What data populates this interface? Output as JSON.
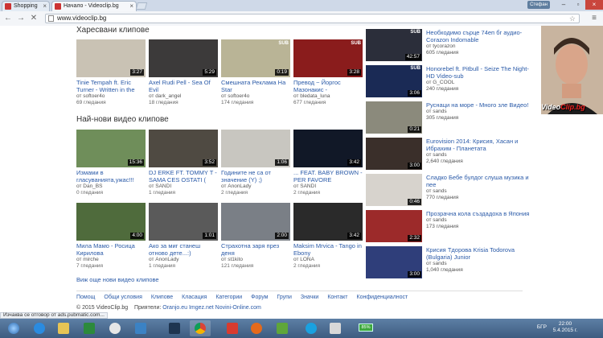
{
  "browser": {
    "tabs": [
      {
        "label": "Shopping",
        "active": false
      },
      {
        "label": "Начало - Videoclip.bg",
        "active": true
      }
    ],
    "user_badge": "Стефан",
    "url": "www.videoclip.bg",
    "status_text": "Изчаква се отговор от ads.pubmatic.com..."
  },
  "sections": {
    "favorites_title": "Харесвани клипове",
    "newest_title": "Най-нови видео клипове",
    "more_link": "Виж още нови видео клипове"
  },
  "favorites": [
    {
      "title": "Tinie Tempah ft. Eric Turner - Written in the",
      "author": "от softoer4o",
      "views": "69 гледания",
      "duration": "3:27",
      "sub": false,
      "color": "#c9c2b4"
    },
    {
      "title": "Axel Rudi Pell - Sea Of Evil",
      "author": "от dark_angel",
      "views": "18 гледания",
      "duration": "5:29",
      "sub": false,
      "color": "#3c3a3a"
    },
    {
      "title": "Смешната Реклама На Star",
      "author": "от softoer4o",
      "views": "174 гледания",
      "duration": "0:19",
      "sub": true,
      "color": "#b9b496"
    },
    {
      "title": "Превод ~ Йоргос Мазонакис -",
      "author": "от bledata_luna",
      "views": "677 гледания",
      "duration": "3:28",
      "sub": true,
      "color": "#8a1c1c"
    }
  ],
  "newest": [
    {
      "title": "Измами в гласуванията,ужас!!!",
      "author": "от Dan_BS",
      "views": "0 гледания",
      "duration": "15:36",
      "sub": false,
      "color": "#6f8e5a"
    },
    {
      "title": "DJ ERKE FT. TOMMY T - SAMA CES OSTATI (",
      "author": "от SANDI",
      "views": "1 гледания",
      "duration": "3:52",
      "sub": false,
      "color": "#4f4a42"
    },
    {
      "title": "Годините не са от значение (Y) ;)",
      "author": "от AnonLady",
      "views": "2 гледания",
      "duration": "1:06",
      "sub": false,
      "color": "#c8c6c0"
    },
    {
      "title": "... FEAT. BABY BROWN - PER FAVORE",
      "author": "от SANDI",
      "views": "2 гледания",
      "duration": "3:42",
      "sub": false,
      "color": "#111827"
    },
    {
      "title": "Мила Мамо - Росица Кирилова",
      "author": "от mirche",
      "views": "7 гледания",
      "duration": "4:00",
      "sub": false,
      "color": "#4f6b3c"
    },
    {
      "title": "Ако за миг станеш отново дете...:)",
      "author": "от AnonLady",
      "views": "1 гледания",
      "duration": "1:01",
      "sub": false,
      "color": "#5a5a5a"
    },
    {
      "title": "Страхотна заря през деня",
      "author": "от st1kito",
      "views": "121 гледания",
      "duration": "2:00",
      "sub": false,
      "color": "#7a7f86"
    },
    {
      "title": "Maksim Mrvica - Tango in Ebony",
      "author": "от LONA",
      "views": "2 гледания",
      "duration": "3:42",
      "sub": false,
      "color": "#2a2a2a"
    }
  ],
  "sidebar": [
    {
      "title": "Необходимо сърце 74еп бг аудио- Corazon Indomable",
      "author": "от tycorazon",
      "views": "605 гледания",
      "duration": "42:57",
      "sub": true,
      "color": "#2b2e3a"
    },
    {
      "title": "Honorebel ft. Pitbull - Seize The Night-HD Video-sub",
      "author": "от G_COOL",
      "views": "240 гледания",
      "duration": "3:06",
      "sub": true,
      "color": "#1a2a55"
    },
    {
      "title": "Руснаци на море - Много зле Видео!",
      "author": "от sands",
      "views": "305 гледания",
      "duration": "0:21",
      "sub": false,
      "color": "#8b8a7c"
    },
    {
      "title": "Eurovision 2014: Крисия, Хасан и Ибрахим - Планетата",
      "author": "от sands",
      "views": "2,640 гледания",
      "duration": "3:00",
      "sub": false,
      "color": "#3a2f2a"
    },
    {
      "title": "Сладко Бебе булдог слуша музика и пее",
      "author": "от sands",
      "views": "770 гледания",
      "duration": "0:46",
      "sub": false,
      "color": "#d7d3cd"
    },
    {
      "title": "Прозрачна кола създадоха в Япония",
      "author": "от sands",
      "views": "173 гледания",
      "duration": "2:32",
      "sub": false,
      "color": "#9c2a2a"
    },
    {
      "title": "Крисия Тдорова Krisia Todorova (Bulgaria) Junior",
      "author": "от sands",
      "views": "1,040 гледания",
      "duration": "3:00",
      "sub": false,
      "color": "#2f3e7a"
    }
  ],
  "ad": {
    "logo_a": "Video",
    "logo_b": "Clip.bg"
  },
  "footer": {
    "links": [
      "Помощ",
      "Общи условия",
      "Клипове",
      "Класация",
      "Категории",
      "Форум",
      "Групи",
      "Значки",
      "Контакт",
      "Конфиденциалност"
    ],
    "copyright": "© 2015 VideoClip.bg",
    "friends_label": "Приятели:",
    "friends": "Oranjo.eu Imgez.net Novini-Online.com"
  },
  "taskbar": {
    "battery": "85%",
    "lang": "БГР",
    "time": "22:00",
    "date": "5.4.2015 г."
  }
}
